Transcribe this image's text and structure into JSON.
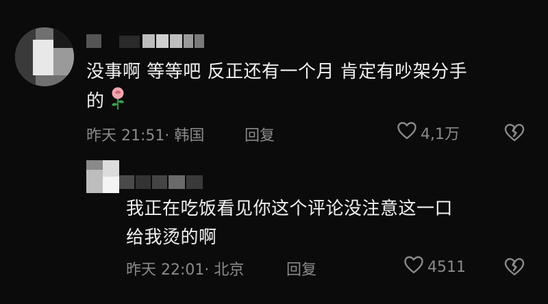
{
  "comments": [
    {
      "text_line1": "没事啊 等等吧 反正还有一个月 肯定有吵架分手",
      "text_line2": "的",
      "emoji": "rose-emoji",
      "time": "昨天 21:51",
      "location": "韩国",
      "reply_label": "回复",
      "like_count": "4,1万",
      "like_icon": "heart-outline-icon",
      "dislike_icon": "broken-heart-icon"
    },
    {
      "text_line1": "我正在吃饭看见你这个评论没注意这一口",
      "text_line2": "给我烫的啊",
      "time": "昨天 22:01",
      "location": "北京",
      "reply_label": "回复",
      "like_count": "4511",
      "like_icon": "heart-outline-icon",
      "dislike_icon": "broken-heart-icon"
    }
  ],
  "colors": {
    "background": "#0b0b0b",
    "text": "#f2f2f2",
    "meta": "#8b8b8b"
  }
}
